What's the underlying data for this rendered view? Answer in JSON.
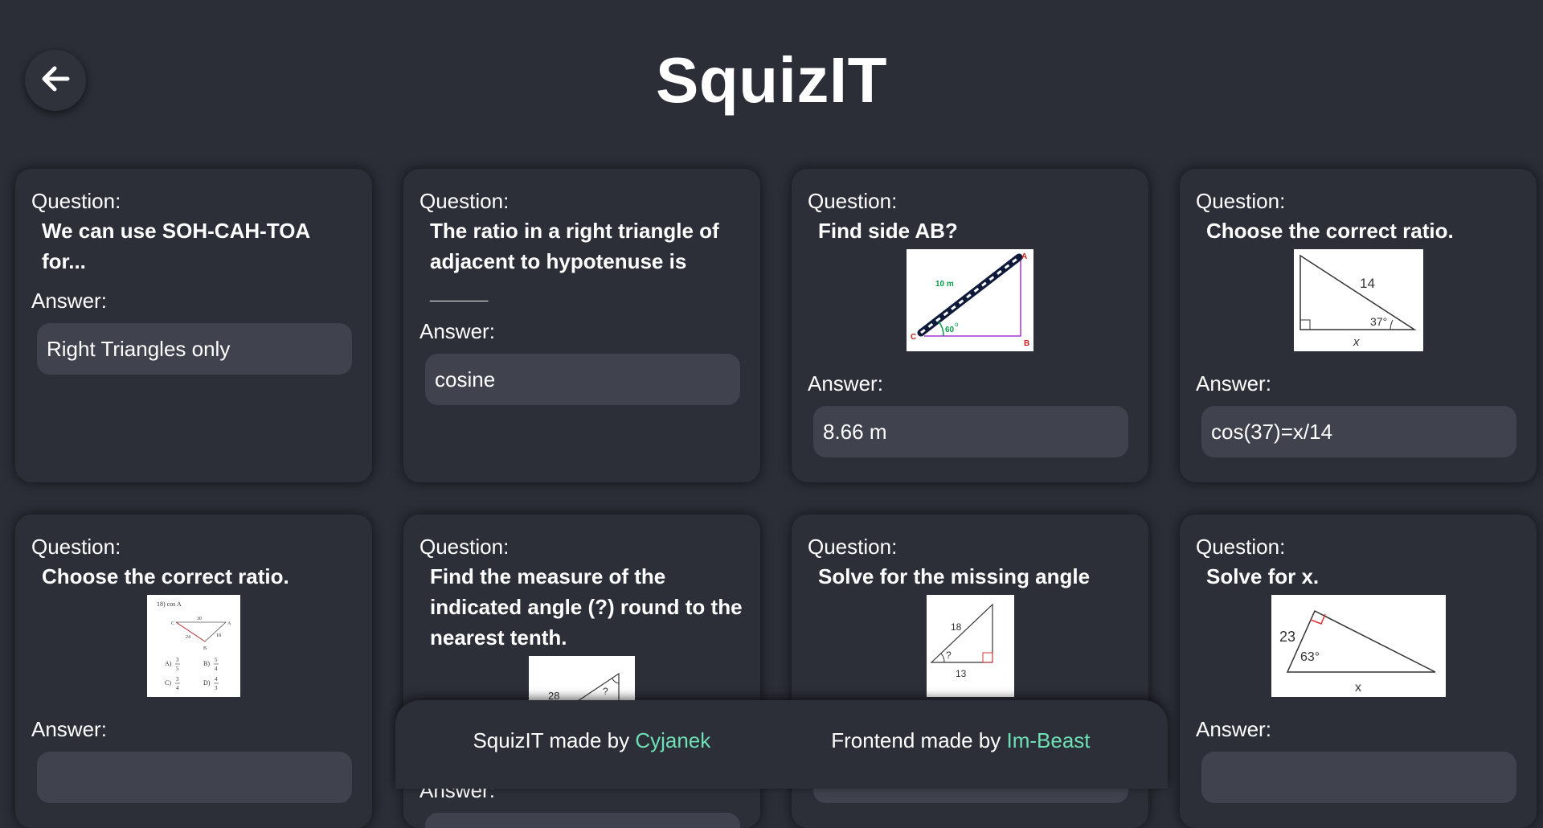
{
  "app": {
    "title": "SquizIT"
  },
  "back_button": {
    "icon": "arrow-left-icon"
  },
  "question_label": "Question:",
  "answer_label": "Answer:",
  "cards": [
    {
      "question": "We can use SOH-CAH-TOA for...",
      "answer": "Right Triangles only"
    },
    {
      "question": "The ratio in a right triangle of adjacent to hypotenuse is _____",
      "answer": "cosine"
    },
    {
      "question": "Find side AB?",
      "answer": "8.66 m",
      "image": {
        "labels": [
          "10 m",
          "60",
          "o",
          "A",
          "B",
          "C"
        ]
      }
    },
    {
      "question": "Choose the correct ratio.",
      "answer": "cos(37)=x/14",
      "image": {
        "labels": [
          "14",
          "37°",
          "x"
        ]
      }
    },
    {
      "question": "Choose the correct ratio.",
      "answer": "",
      "image": {
        "labels": [
          "18) cos A",
          "C",
          "30",
          "A",
          "24",
          "18",
          "B",
          "A)",
          "3",
          "5",
          "B)",
          "5",
          "4",
          "C)",
          "3",
          "4",
          "D)",
          "4",
          "3"
        ]
      }
    },
    {
      "question": "Find the measure of the indicated angle (?) round to the nearest tenth.",
      "answer": "",
      "image": {
        "labels": [
          "28",
          "?"
        ]
      }
    },
    {
      "question": "Solve for the missing angle",
      "answer": "",
      "image": {
        "labels": [
          "18",
          "?",
          "13"
        ]
      }
    },
    {
      "question": "Solve for x.",
      "answer": "",
      "image": {
        "labels": [
          "23",
          "63°",
          "x"
        ]
      }
    }
  ],
  "footer": {
    "credit1_prefix": "SquizIT made by ",
    "credit1_link": "Cyjanek",
    "credit2_prefix": "Frontend made by ",
    "credit2_link": "Im-Beast",
    "link_color": "#6fe0b5"
  }
}
